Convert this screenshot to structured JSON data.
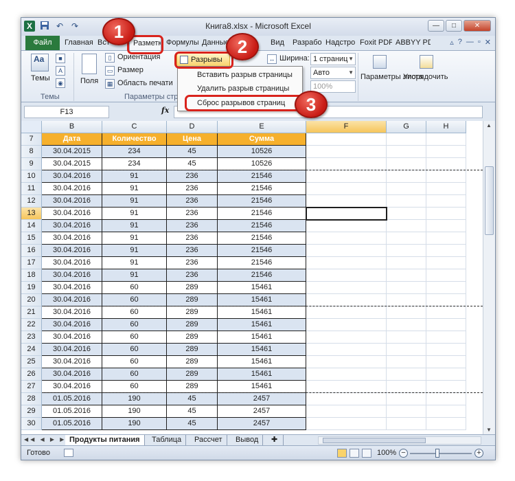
{
  "window": {
    "title": "Книга8.xlsx - Microsoft Excel"
  },
  "qat": {
    "excel_icon": "X",
    "save_icon": "save-icon",
    "undo": "↶",
    "redo": "↷"
  },
  "tabs": [
    {
      "label": "Файл",
      "kind": "file"
    },
    {
      "label": "Главная"
    },
    {
      "label": "Вст"
    },
    {
      "label": "Разметка",
      "active": true
    },
    {
      "label": "Формулы"
    },
    {
      "label": "Данные"
    },
    {
      "label": "Рец"
    },
    {
      "label": "Вид"
    },
    {
      "label": "Разрабо"
    },
    {
      "label": "Надстро"
    },
    {
      "label": "Foxit PDF"
    },
    {
      "label": "ABBYY PD"
    }
  ],
  "ribbon": {
    "themes_label": "Темы",
    "themes_group": "Темы",
    "fields_label": "Поля",
    "orientation_label": "Ориентация",
    "size_label": "Размер",
    "print_area_label": "Область печати",
    "page_setup_group": "Параметры стр",
    "breaks_label": "Разрывы",
    "width_label": "Ширина:",
    "width_value": "1 страниц",
    "height_value": "Авто",
    "scale_value": "100%",
    "sheet_params_label": "Параметры листа",
    "arrange_label": "Упорядочить"
  },
  "dropdown": {
    "insert_break": "Вставить разрыв страницы",
    "remove_break": "Удалить разрыв страницы",
    "reset_breaks": "Сброс разрывов страниц"
  },
  "annotations": {
    "step1": "1",
    "step2": "2",
    "step3": "3"
  },
  "formula_bar": {
    "name_box": "F13",
    "fx": "fx",
    "formula": ""
  },
  "sheet": {
    "columns": [
      "B",
      "C",
      "D",
      "E",
      "F",
      "G",
      "H"
    ],
    "header_row": {
      "row": "7",
      "cells": [
        "Дата",
        "Количество",
        "Цена",
        "Сумма"
      ]
    },
    "rows": [
      {
        "row": "8",
        "cells": [
          "30.04.2015",
          "234",
          "45",
          "10526"
        ]
      },
      {
        "row": "9",
        "cells": [
          "30.04.2015",
          "234",
          "45",
          "10526"
        ]
      },
      {
        "row": "10",
        "cells": [
          "30.04.2016",
          "91",
          "236",
          "21546"
        ]
      },
      {
        "row": "11",
        "cells": [
          "30.04.2016",
          "91",
          "236",
          "21546"
        ]
      },
      {
        "row": "12",
        "cells": [
          "30.04.2016",
          "91",
          "236",
          "21546"
        ]
      },
      {
        "row": "13",
        "cells": [
          "30.04.2016",
          "91",
          "236",
          "21546"
        ]
      },
      {
        "row": "14",
        "cells": [
          "30.04.2016",
          "91",
          "236",
          "21546"
        ]
      },
      {
        "row": "15",
        "cells": [
          "30.04.2016",
          "91",
          "236",
          "21546"
        ]
      },
      {
        "row": "16",
        "cells": [
          "30.04.2016",
          "91",
          "236",
          "21546"
        ]
      },
      {
        "row": "17",
        "cells": [
          "30.04.2016",
          "91",
          "236",
          "21546"
        ]
      },
      {
        "row": "18",
        "cells": [
          "30.04.2016",
          "91",
          "236",
          "21546"
        ]
      },
      {
        "row": "19",
        "cells": [
          "30.04.2016",
          "60",
          "289",
          "15461"
        ]
      },
      {
        "row": "20",
        "cells": [
          "30.04.2016",
          "60",
          "289",
          "15461"
        ]
      },
      {
        "row": "21",
        "cells": [
          "30.04.2016",
          "60",
          "289",
          "15461"
        ]
      },
      {
        "row": "22",
        "cells": [
          "30.04.2016",
          "60",
          "289",
          "15461"
        ]
      },
      {
        "row": "23",
        "cells": [
          "30.04.2016",
          "60",
          "289",
          "15461"
        ]
      },
      {
        "row": "24",
        "cells": [
          "30.04.2016",
          "60",
          "289",
          "15461"
        ]
      },
      {
        "row": "25",
        "cells": [
          "30.04.2016",
          "60",
          "289",
          "15461"
        ]
      },
      {
        "row": "26",
        "cells": [
          "30.04.2016",
          "60",
          "289",
          "15461"
        ]
      },
      {
        "row": "27",
        "cells": [
          "30.04.2016",
          "60",
          "289",
          "15461"
        ]
      },
      {
        "row": "28",
        "cells": [
          "01.05.2016",
          "190",
          "45",
          "2457"
        ]
      },
      {
        "row": "29",
        "cells": [
          "01.05.2016",
          "190",
          "45",
          "2457"
        ]
      },
      {
        "row": "30",
        "cells": [
          "01.05.2016",
          "190",
          "45",
          "2457"
        ]
      }
    ],
    "page_breaks_after_rows": [
      "9",
      "20",
      "27"
    ],
    "selected_row": "13",
    "selected_column": "F"
  },
  "sheet_tabs": [
    "Продукты питания",
    "Таблица",
    "Рассчет",
    "Вывод"
  ],
  "active_sheet_tab": "Продукты питания",
  "status": {
    "ready": "Готово",
    "zoom": "100%"
  },
  "colors": {
    "header_fill": "#f6b02c",
    "alt_fill": "#dae4f1",
    "annotation_red": "#d9231c",
    "file_tab": "#2a7a3d"
  }
}
